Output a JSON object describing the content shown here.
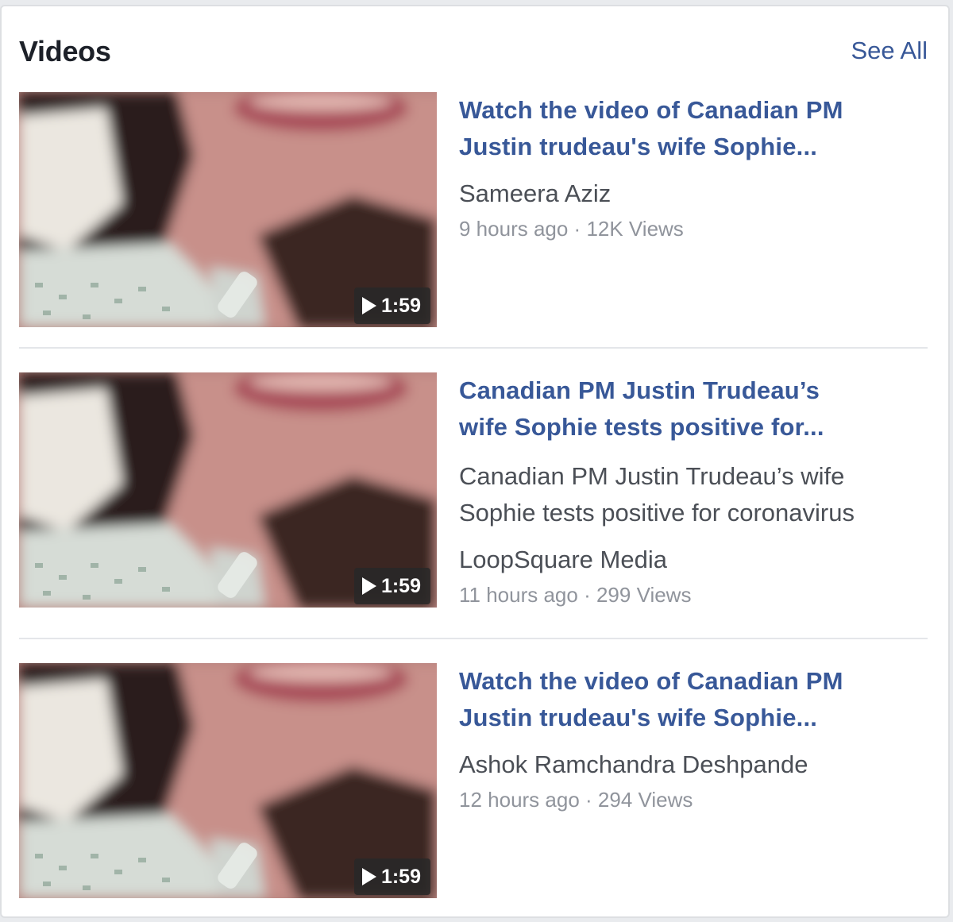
{
  "panel": {
    "title": "Videos",
    "see_all": "See All"
  },
  "videos": [
    {
      "title_line1": "Watch the video of Canadian PM",
      "title_line2": "Justin trudeau's wife Sophie...",
      "description": "",
      "author": "Sameera Aziz",
      "time": "9 hours ago",
      "separator": " · ",
      "views": "12K Views",
      "duration": "1:59"
    },
    {
      "title_line1": "Canadian PM Justin Trudeau’s",
      "title_line2": "wife Sophie tests positive for...",
      "description_line1": "Canadian PM Justin Trudeau’s wife",
      "description_line2": "Sophie tests positive for coronavirus",
      "author": "LoopSquare Media",
      "time": "11 hours ago",
      "separator": " · ",
      "views": "299 Views",
      "duration": "1:59"
    },
    {
      "title_line1": "Watch the video of Canadian PM",
      "title_line2": "Justin trudeau's wife Sophie...",
      "description": "",
      "author": "Ashok Ramchandra Deshpande",
      "time": "12 hours ago",
      "separator": " · ",
      "views": "294 Views",
      "duration": "1:59"
    }
  ],
  "icons": {
    "play": "play-icon"
  }
}
